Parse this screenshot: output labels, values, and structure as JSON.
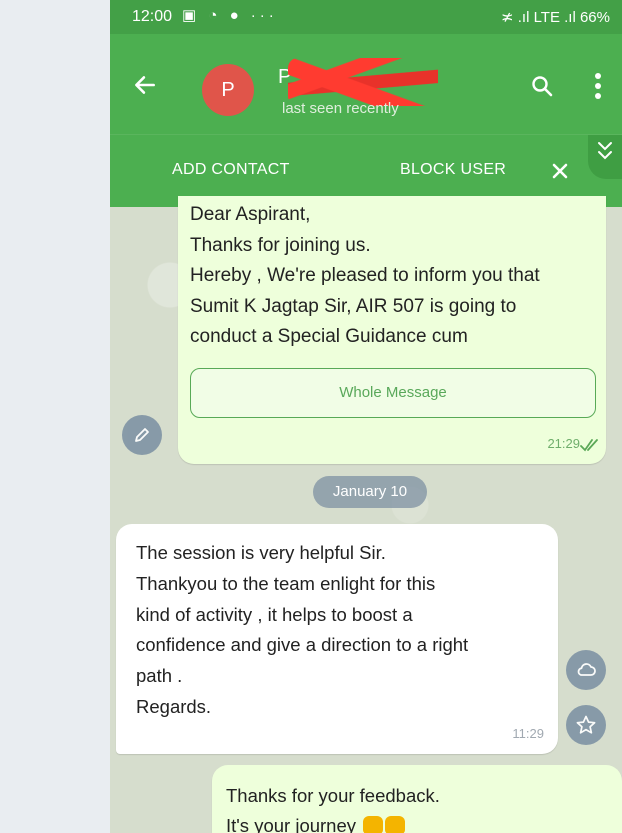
{
  "status_bar": {
    "time": "12:00",
    "left_icons": "▣ ◔ ● ···",
    "right_text": "≭ .ıl LTE .ıl 66%"
  },
  "header": {
    "avatar_letter": "P",
    "name": "P",
    "last_seen": "last seen recently"
  },
  "action_bar": {
    "add_contact": "ADD CONTACT",
    "block_user": "BLOCK USER"
  },
  "messages": [
    {
      "direction": "outgoing",
      "lines": [
        "Dear Aspirant,",
        "Thanks for joining us.",
        "Hereby , We're pleased to inform you that",
        "Sumit K Jagtap Sir, AIR 507 is going to",
        "conduct a Special Guidance cum"
      ],
      "button_label": "Whole Message",
      "time": "21:29"
    },
    {
      "direction": "incoming",
      "lines": [
        "The session is very helpful Sir.",
        "Thankyou to the team enlight for this",
        "kind of activity , it helps to boost a",
        "confidence and give a direction to a right",
        "path .",
        "Regards."
      ],
      "time": "11:29"
    },
    {
      "direction": "outgoing",
      "lines": [
        "Thanks for your feedback.",
        "It's your journey"
      ]
    }
  ],
  "date_chip": "January 10",
  "colors": {
    "header_green": "#4caf50",
    "outgoing_bubble": "#eeffdb",
    "incoming_bubble": "#ffffff"
  }
}
